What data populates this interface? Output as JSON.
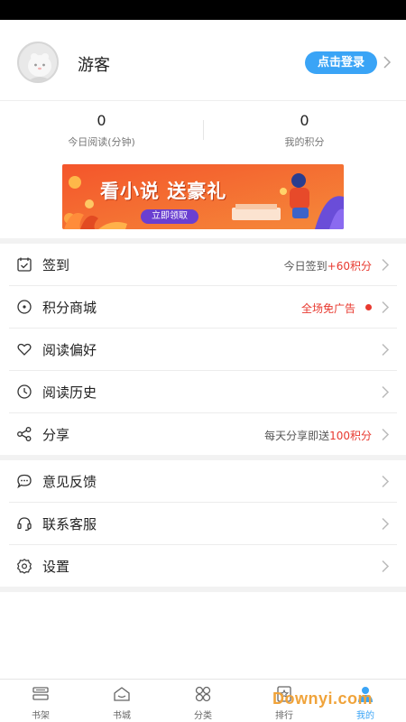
{
  "profile": {
    "username": "游客",
    "login_label": "点击登录"
  },
  "stats": [
    {
      "value": "0",
      "label": "今日阅读(分钟)"
    },
    {
      "value": "0",
      "label": "我的积分"
    }
  ],
  "banner": {
    "title": "看小说 送豪礼",
    "button_label": "立即领取"
  },
  "menu_group1": [
    {
      "label": "签到",
      "icon": "calendar-icon",
      "hint_prefix": "今日签到",
      "hint_highlight": "+60积分",
      "hint_suffix": ""
    },
    {
      "label": "积分商城",
      "icon": "compass-icon",
      "hint_prefix": "",
      "hint_highlight": "全场免广告",
      "hint_suffix": ""
    },
    {
      "label": "阅读偏好",
      "icon": "heart-icon",
      "hint_prefix": "",
      "hint_highlight": "",
      "hint_suffix": ""
    },
    {
      "label": "阅读历史",
      "icon": "clock-icon",
      "hint_prefix": "",
      "hint_highlight": "",
      "hint_suffix": ""
    },
    {
      "label": "分享",
      "icon": "share-icon",
      "hint_prefix": "每天分享即送",
      "hint_highlight": "100积分",
      "hint_suffix": ""
    }
  ],
  "menu_group2": [
    {
      "label": "意见反馈",
      "icon": "chat-icon"
    },
    {
      "label": "联系客服",
      "icon": "headset-icon"
    },
    {
      "label": "设置",
      "icon": "gear-icon"
    }
  ],
  "tabbar": [
    {
      "label": "书架",
      "icon": "bookshelf-icon",
      "active": false
    },
    {
      "label": "书城",
      "icon": "store-icon",
      "active": false
    },
    {
      "label": "分类",
      "icon": "category-icon",
      "active": false
    },
    {
      "label": "排行",
      "icon": "ranking-icon",
      "active": false
    },
    {
      "label": "我的",
      "icon": "user-icon",
      "active": true
    }
  ],
  "watermark": "Downyi.com",
  "colors": {
    "accent": "#3aa4f6",
    "highlight_red": "#e8392f",
    "banner_orange": "#f26a2e"
  }
}
